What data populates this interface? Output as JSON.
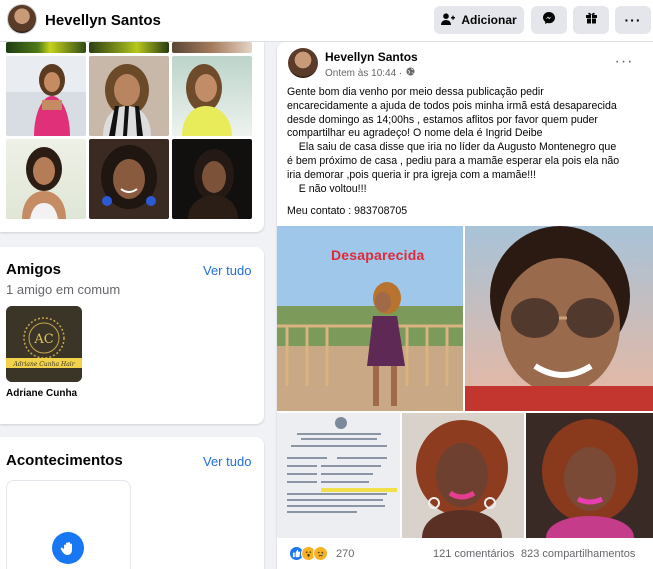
{
  "header": {
    "profile_name": "Hevellyn Santos",
    "add_label": "Adicionar",
    "icons": [
      "user-plus-icon",
      "messenger-icon",
      "gift-icon",
      "more-icon"
    ]
  },
  "photos": {
    "tiles": [
      "photo-1",
      "photo-2",
      "photo-3",
      "photo-4",
      "photo-5",
      "photo-6",
      "photo-7",
      "photo-8",
      "photo-9"
    ]
  },
  "friends": {
    "title": "Amigos",
    "see_all": "Ver tudo",
    "mutual": "1 amigo em comum",
    "friend_name": "Adriane Cunha"
  },
  "events": {
    "title": "Acontecimentos",
    "see_all": "Ver tudo"
  },
  "post": {
    "author": "Hevellyn Santos",
    "time": "Ontem às 10:44 ·",
    "body": "Gente bom dia venho por meio dessa publicação pedir\nencarecidamente a ajuda de todos pois minha irmã está desaparecida\ndesde domingo as 14;00hs , estamos aflitos por favor quem puder\ncompartilhar eu agradeço! O nome dela é Ingrid Deibe\n    Ela saiu de casa disse que iria no líder da Augusto Montenegro que\né bem próximo de casa , pediu para a mamãe esperar ela pois ela não\niria demorar ,pois queria ir pra igreja com a mamãe!!!\n    E não voltou!!!",
    "contact": "Meu contato : 983708705",
    "image_label": "Desaparecida",
    "reaction_count": "270",
    "comments": "121 comentários",
    "shares": "823 compartilhamentos"
  },
  "colors": {
    "link": "#216fdb",
    "background": "#f0f2f5",
    "alert": "#e02a3a"
  }
}
